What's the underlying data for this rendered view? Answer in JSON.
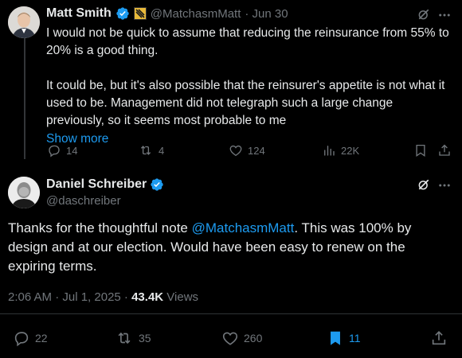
{
  "reply": {
    "author_name": "Matt Smith",
    "handle": "@MatchasmMatt",
    "date": "· Jun 30",
    "para1": "I would not be quick to assume that reducing the reinsurance from 55% to 20% is a good thing.",
    "para2": "It could be, but it's also possible that the reinsurer's appetite is not what it used to be. Management did not telegraph such a large change previously, so it seems most probable to me",
    "show_more": "Show more",
    "replies": "14",
    "reposts": "4",
    "likes": "124",
    "views": "22K"
  },
  "main": {
    "author_name": "Daniel Schreiber",
    "handle": "@daschreiber",
    "text_before": "Thanks for the thoughtful note ",
    "mention": "@MatchasmMatt",
    "text_after": ". This was 100% by design and at our election. Would have been easy to renew on the expiring terms.",
    "timestamp": "2:06 AM · Jul 1, 2025 · ",
    "views_count": "43.4K",
    "views_label": " Views",
    "replies": "22",
    "reposts": "35",
    "likes": "260",
    "bookmarks": "11"
  },
  "colors": {
    "accent": "#1d9bf0",
    "muted": "#71767b",
    "text": "#e7e9ea",
    "background": "#000000"
  },
  "icons": [
    "verified-badge-icon",
    "affiliate-badge-icon",
    "grok-icon",
    "more-icon",
    "reply-icon",
    "repost-icon",
    "like-icon",
    "views-icon",
    "bookmark-icon",
    "share-icon"
  ]
}
